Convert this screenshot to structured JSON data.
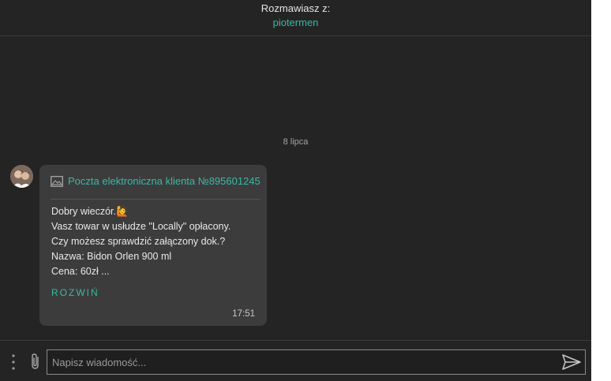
{
  "header": {
    "label": "Rozmawiasz z:",
    "username": "piotermen"
  },
  "date_separator": "8 lipca",
  "message": {
    "subject": "Poczta elektroniczna klienta №895601245",
    "lines": [
      "Dobry wieczór.🙋",
      "Vasz towar w usłudze \"Locally\" opłacony.",
      "Czy możesz sprawdzić załączony dok.?",
      "Nazwa: Bidon Orlen 900 ml",
      "Cena: 60zł ..."
    ],
    "expand_label": "ROZWIŃ",
    "time": "17:51"
  },
  "composer": {
    "placeholder": "Napisz wiadomość..."
  },
  "icons": {
    "menu": "kebab-menu-icon",
    "attach": "paperclip-icon",
    "send": "send-icon",
    "image": "image-icon"
  },
  "colors": {
    "background": "#242424",
    "bubble": "#3c3c3c",
    "accent": "#3bb8a4",
    "text": "#e9e9e9"
  }
}
